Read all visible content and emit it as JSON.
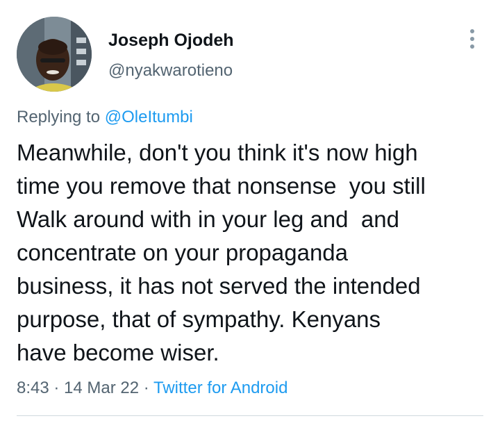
{
  "author": {
    "name": "Joseph Ojodeh",
    "handle": "@nyakwarotieno",
    "avatar_icon": "profile-photo"
  },
  "more_icon": "more-vertical-icon",
  "reply": {
    "prefix": "Replying to ",
    "mention": "@OleItumbi"
  },
  "tweet": {
    "text": "Meanwhile, don't you think it's now high\ntime you remove that nonsense  you still\nWalk around with in your leg and  and\nconcentrate on your propaganda\nbusiness, it has not served the intended\npurpose, that of sympathy. Kenyans\nhave become wiser."
  },
  "meta": {
    "time": "8:43",
    "separator1": " · ",
    "date": "14 Mar 22",
    "separator2": " · ",
    "source": "Twitter for Android"
  },
  "colors": {
    "text": "#0f1419",
    "secondary": "#536471",
    "link": "#1d9bf0",
    "divider": "#cfd9de"
  }
}
